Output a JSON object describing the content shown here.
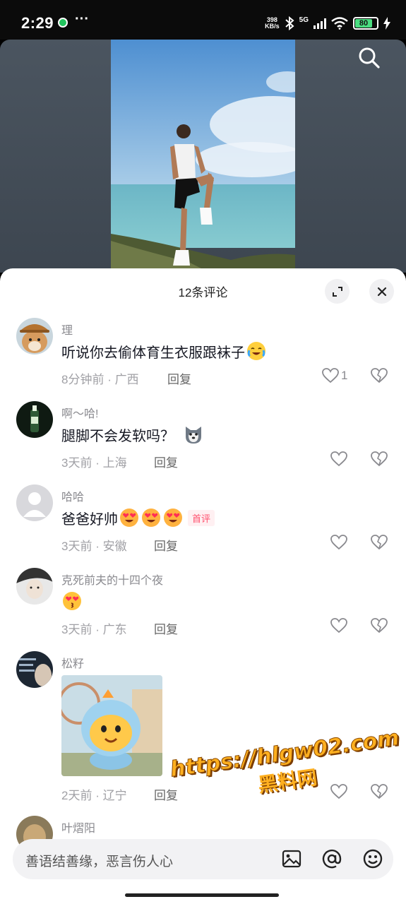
{
  "status_bar": {
    "time": "2:29",
    "more": "···",
    "net_speed_top": "398",
    "net_speed_bottom": "KB/s",
    "network": "5G",
    "battery": "80",
    "icons": [
      "app-dot-icon",
      "bluetooth-icon",
      "signal-icon",
      "wifi-icon",
      "battery-icon",
      "charging-icon"
    ]
  },
  "video": {
    "icons": [
      "search-icon"
    ]
  },
  "sheet": {
    "title": "12条评论",
    "icons": [
      "expand-icon",
      "close-icon"
    ]
  },
  "comments": [
    {
      "user": "理",
      "text": "听说你去偷体育生衣服跟袜子",
      "emojis": [
        "crying-laugh-emoji"
      ],
      "time": "8分钟前",
      "location": "广西",
      "reply": "回复",
      "likes": "1"
    },
    {
      "user": "啊～哈!",
      "text": "腿脚不会发软吗？",
      "emojis": [
        "husky-emoji"
      ],
      "time": "3天前",
      "location": "上海",
      "reply": "回复",
      "likes": ""
    },
    {
      "user": "哈哈",
      "text": "爸爸好帅",
      "emojis": [
        "heart-eyes-emoji",
        "heart-eyes-emoji",
        "heart-eyes-emoji"
      ],
      "badge": "首评",
      "time": "3天前",
      "location": "安徽",
      "reply": "回复",
      "likes": ""
    },
    {
      "user": "克死前夫的十四个夜",
      "text": "",
      "emojis": [
        "kiss-emoji"
      ],
      "time": "3天前",
      "location": "广东",
      "reply": "回复",
      "likes": ""
    },
    {
      "user": "松籽",
      "text": "",
      "image": "cartoon-dragon-sticker",
      "time": "2天前",
      "location": "辽宁",
      "reply": "回复",
      "likes": ""
    },
    {
      "user": "叶熠阳"
    }
  ],
  "meta_separator": " · ",
  "input": {
    "placeholder": "善语结善缘，恶言伤人心",
    "icons": [
      "image-icon",
      "at-icon",
      "emoji-icon"
    ]
  },
  "watermark": {
    "line1": "https://hlgw02.com",
    "line2": "黑料网"
  },
  "colors": {
    "status_bg": "#0b0b0b",
    "sheet_bg": "#ffffff",
    "badge": "#ff4f6d",
    "watermark": "#ffb020"
  }
}
